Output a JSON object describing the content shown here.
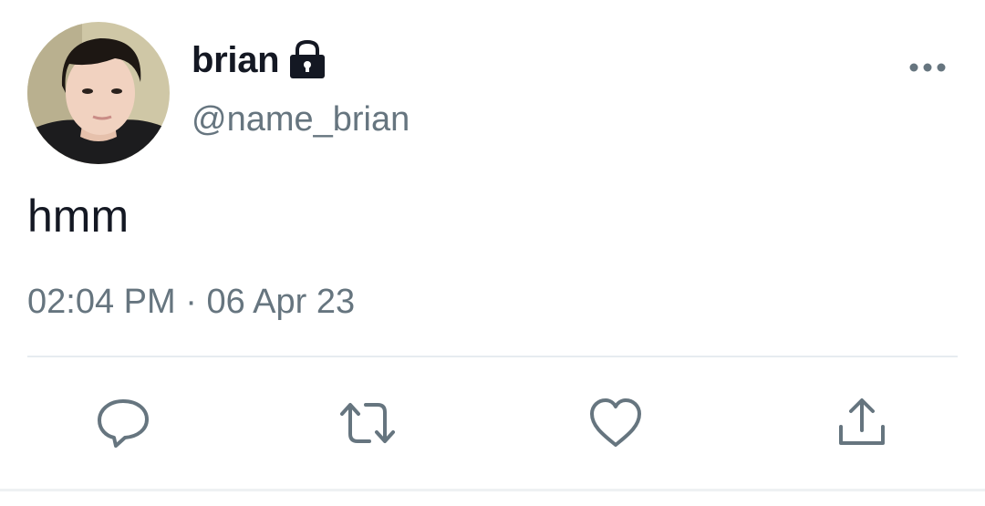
{
  "tweet": {
    "display_name": "brian",
    "handle": "@name_brian",
    "text": "hmm",
    "time": "02:04 PM",
    "separator": "·",
    "date": "06 Apr 23",
    "protected_icon": "lock-icon",
    "more_icon": "more-dots-icon"
  },
  "actions": [
    {
      "name": "reply",
      "icon": "comment-icon"
    },
    {
      "name": "retweet",
      "icon": "retweet-icon"
    },
    {
      "name": "like",
      "icon": "heart-icon"
    },
    {
      "name": "share",
      "icon": "share-icon"
    }
  ],
  "colors": {
    "primary_text": "#141823",
    "secondary_text": "#66757f",
    "icon": "#66757f",
    "divider": "#e6ecf0",
    "background": "#ffffff"
  }
}
